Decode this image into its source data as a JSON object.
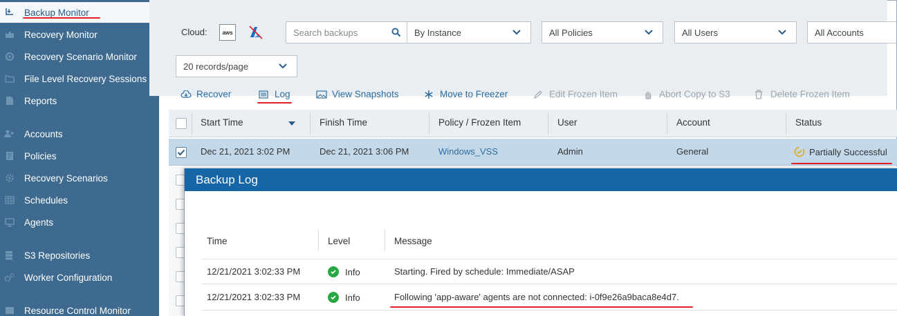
{
  "sidebar": {
    "items": [
      {
        "label": "Backup Monitor",
        "icon": "backup-monitor-icon",
        "active": true
      },
      {
        "label": "Recovery Monitor",
        "icon": "recovery-monitor-icon"
      },
      {
        "label": "Recovery Scenario Monitor",
        "icon": "scenario-monitor-icon"
      },
      {
        "label": "File Level Recovery Sessions",
        "icon": "folder-icon"
      },
      {
        "label": "Reports",
        "icon": "report-icon"
      },
      {
        "label": "Accounts",
        "icon": "accounts-icon"
      },
      {
        "label": "Policies",
        "icon": "policies-icon"
      },
      {
        "label": "Recovery Scenarios",
        "icon": "gear-icon"
      },
      {
        "label": "Schedules",
        "icon": "calendar-icon"
      },
      {
        "label": "Agents",
        "icon": "monitor-icon"
      },
      {
        "label": "S3 Repositories",
        "icon": "storage-icon"
      },
      {
        "label": "Worker Configuration",
        "icon": "gears-icon"
      },
      {
        "label": "Resource Control Monitor",
        "icon": "resource-icon"
      }
    ]
  },
  "filters": {
    "cloud_label": "Cloud:",
    "aws_label": "aws",
    "search_placeholder": "Search backups",
    "by_instance": "By Instance",
    "all_policies": "All Policies",
    "all_users": "All Users",
    "all_accounts": "All Accounts",
    "records_per_page": "20 records/page"
  },
  "toolbar": {
    "recover": "Recover",
    "log": "Log",
    "view_snapshots": "View Snapshots",
    "move_to_freezer": "Move to Freezer",
    "edit_frozen_item": "Edit Frozen Item",
    "abort_copy": "Abort Copy to S3",
    "delete_frozen_item": "Delete Frozen Item"
  },
  "table": {
    "columns": [
      "Start Time",
      "Finish Time",
      "Policy / Frozen Item",
      "User",
      "Account",
      "Status"
    ],
    "selected_row": {
      "start_time": "Dec 21, 2021 3:02 PM",
      "finish_time": "Dec 21, 2021 3:06 PM",
      "policy": "Windows_VSS",
      "user": "Admin",
      "account": "General",
      "status": "Partially Successful"
    }
  },
  "backup_log": {
    "title": "Backup Log",
    "columns": [
      "Time",
      "Level",
      "Message"
    ],
    "rows": [
      {
        "time": "12/21/2021 3:02:33 PM",
        "level": "Info",
        "message": "Starting. Fired by schedule: Immediate/ASAP"
      },
      {
        "time": "12/21/2021 3:02:33 PM",
        "level": "Info",
        "message": "Following 'app-aware' agents are not connected: i-0f9e26a9baca8e4d7."
      }
    ]
  },
  "colors": {
    "sidebar_bg": "#3d6a8e",
    "accent_blue": "#1565a7",
    "link_blue": "#2e6c9e",
    "annotation_red": "#e41e26",
    "status_warning": "#e8a317",
    "info_green": "#29a745"
  }
}
